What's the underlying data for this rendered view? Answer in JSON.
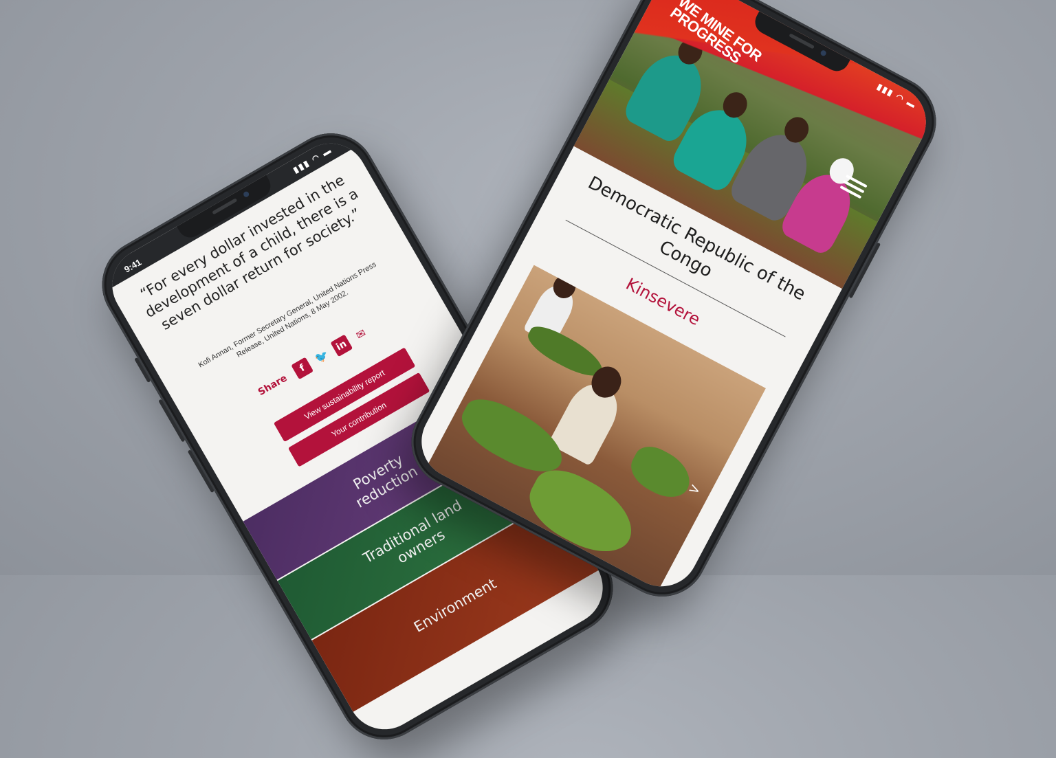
{
  "left_phone": {
    "status_time": "9:41",
    "status_icons": "▮▮▮ ◠ ▬",
    "quote": "“For every dollar invested in the development of a child, there is a seven dollar return for society.”",
    "attribution": "Kofi Annan, Former Secretary General, United Nations Press Release, United Nations, 8 May 2002.",
    "share_label": "Share",
    "share_icons": [
      "facebook-icon",
      "twitter-icon",
      "linkedin-icon",
      "email-icon"
    ],
    "share_glyphs": {
      "facebook": "f",
      "twitter": "🐦",
      "linkedin": "in",
      "email": "✉"
    },
    "buttons": {
      "report": "View sustainability report",
      "contribution": "Your contribution"
    },
    "tiles": [
      {
        "label": "Poverty reduction",
        "color": "#5a356f"
      },
      {
        "label": "Traditional land owners",
        "color": "#276a3a"
      },
      {
        "label": "Environment",
        "color": "#8a3018"
      }
    ]
  },
  "right_phone": {
    "status_icons": "▮▮▮ ◠ ▬",
    "tagline": "WE MINE FOR PROGRESS",
    "country_title": "Democratic Republic of the Congo",
    "site_name": "Kinsevere",
    "next_arrow": ">"
  },
  "colors": {
    "brand_red": "#b3123b",
    "banner_red": "#e0321f"
  }
}
